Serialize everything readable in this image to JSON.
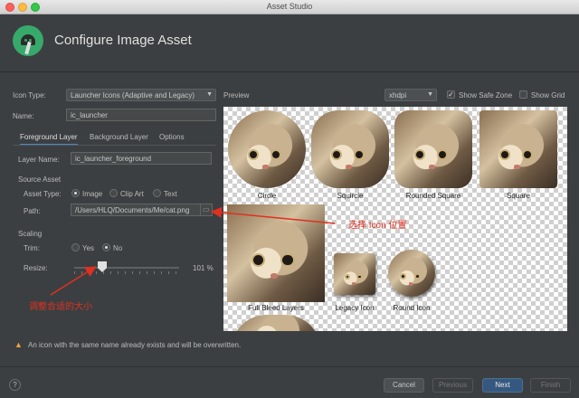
{
  "window": {
    "title": "Asset Studio"
  },
  "header": {
    "title": "Configure Image Asset"
  },
  "form": {
    "icon_type_label": "Icon Type:",
    "icon_type_value": "Launcher Icons (Adaptive and Legacy)",
    "name_label": "Name:",
    "name_value": "ic_launcher",
    "tabs": [
      {
        "label": "Foreground Layer",
        "active": true
      },
      {
        "label": "Background Layer",
        "active": false
      },
      {
        "label": "Options",
        "active": false
      }
    ],
    "layer_name_label": "Layer Name:",
    "layer_name_value": "ic_launcher_foreground",
    "source_asset_heading": "Source Asset",
    "asset_type_label": "Asset Type:",
    "asset_types": [
      {
        "label": "Image",
        "selected": true
      },
      {
        "label": "Clip Art",
        "selected": false
      },
      {
        "label": "Text",
        "selected": false
      }
    ],
    "path_label": "Path:",
    "path_value": "/Users/HLQ/Documents/Me/cat.png",
    "scaling_heading": "Scaling",
    "trim_label": "Trim:",
    "trim_options": [
      {
        "label": "Yes",
        "selected": false
      },
      {
        "label": "No",
        "selected": true
      }
    ],
    "resize_label": "Resize:",
    "resize_value": "101 %",
    "resize_percent": 101
  },
  "preview": {
    "label": "Preview",
    "density": "xhdpi",
    "show_safe_zone_label": "Show Safe Zone",
    "show_safe_zone": true,
    "show_grid_label": "Show Grid",
    "show_grid": false,
    "shapes": [
      "Circle",
      "Squircle",
      "Rounded Square",
      "Square",
      "Full Bleed Layers",
      "Legacy Icon",
      "Round Icon"
    ]
  },
  "annotations": {
    "path_note": "选择 Icon 位置",
    "resize_note": "调整合适的大小"
  },
  "warning": {
    "text": "An icon with the same name already exists and will be overwritten."
  },
  "footer": {
    "help": "?",
    "cancel": "Cancel",
    "previous": "Previous",
    "next": "Next",
    "finish": "Finish"
  },
  "colors": {
    "annotation": "#e03020",
    "primary_button": "#365880",
    "warning": "#e8a33e"
  }
}
